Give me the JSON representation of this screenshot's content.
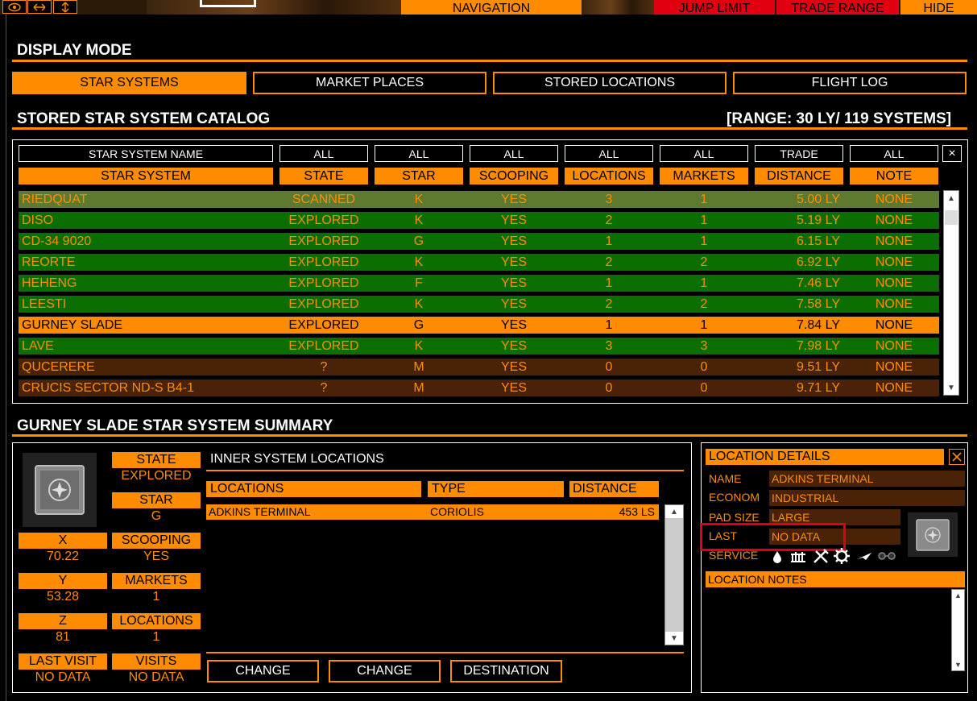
{
  "topbar": {
    "navigation": "NAVIGATION",
    "jump_limit": "JUMP LIMIT",
    "trade_range": "TRADE RANGE",
    "hide": "HIDE",
    "icons": [
      "eye-icon",
      "horizontal-arrows-icon",
      "vertical-arrows-icon"
    ]
  },
  "display_mode": {
    "title": "DISPLAY MODE",
    "buttons": [
      "STAR SYSTEMS",
      "MARKET PLACES",
      "STORED LOCATIONS",
      "FLIGHT LOG"
    ],
    "active": 0
  },
  "catalog": {
    "title": "STORED STAR SYSTEM CATALOG",
    "range": "[RANGE: 30 LY/ 119 SYSTEMS]",
    "filters": [
      "STAR SYSTEM NAME",
      "ALL",
      "ALL",
      "ALL",
      "ALL",
      "ALL",
      "TRADE",
      "ALL"
    ],
    "close": "×",
    "headers": [
      "STAR SYSTEM",
      "STATE",
      "STAR",
      "SCOOPING",
      "LOCATIONS",
      "MARKETS",
      "DISTANCE",
      "NOTE"
    ],
    "rows": [
      {
        "name": "RIEDQUAT",
        "state": "SCANNED",
        "star": "K",
        "scooping": "YES",
        "locations": "3",
        "markets": "1",
        "distance": "5.00 LY",
        "note": "NONE",
        "style": "sc"
      },
      {
        "name": "DISO",
        "state": "EXPLORED",
        "star": "K",
        "scooping": "YES",
        "locations": "2",
        "markets": "1",
        "distance": "5.19 LY",
        "note": "NONE",
        "style": "g"
      },
      {
        "name": "CD-34 9020",
        "state": "EXPLORED",
        "star": "G",
        "scooping": "YES",
        "locations": "1",
        "markets": "1",
        "distance": "6.15 LY",
        "note": "NONE",
        "style": "g"
      },
      {
        "name": "REORTE",
        "state": "EXPLORED",
        "star": "K",
        "scooping": "YES",
        "locations": "2",
        "markets": "2",
        "distance": "6.92 LY",
        "note": "NONE",
        "style": "g"
      },
      {
        "name": "HEHENG",
        "state": "EXPLORED",
        "star": "F",
        "scooping": "YES",
        "locations": "1",
        "markets": "1",
        "distance": "7.46 LY",
        "note": "NONE",
        "style": "g"
      },
      {
        "name": "LEESTI",
        "state": "EXPLORED",
        "star": "K",
        "scooping": "YES",
        "locations": "2",
        "markets": "2",
        "distance": "7.58 LY",
        "note": "NONE",
        "style": "g"
      },
      {
        "name": "GURNEY SLADE",
        "state": "EXPLORED",
        "star": "G",
        "scooping": "YES",
        "locations": "1",
        "markets": "1",
        "distance": "7.84 LY",
        "note": "NONE",
        "style": "sel"
      },
      {
        "name": "LAVE",
        "state": "EXPLORED",
        "star": "K",
        "scooping": "YES",
        "locations": "3",
        "markets": "3",
        "distance": "7.98 LY",
        "note": "NONE",
        "style": "g"
      },
      {
        "name": "QUCERERE",
        "state": "?",
        "star": "M",
        "scooping": "YES",
        "locations": "0",
        "markets": "0",
        "distance": "9.51 LY",
        "note": "NONE",
        "style": "r"
      },
      {
        "name": "CRUCIS SECTOR ND-S B4-1",
        "state": "?",
        "star": "M",
        "scooping": "YES",
        "locations": "0",
        "markets": "0",
        "distance": "9.71 LY",
        "note": "NONE",
        "style": "r"
      }
    ]
  },
  "summary": {
    "title": "GURNEY SLADE STAR SYSTEM SUMMARY",
    "state_label": "STATE",
    "state_value": "EXPLORED",
    "star_label": "STAR",
    "star_value": "G",
    "x_label": "X",
    "x_value": "70.22",
    "scooping_label": "SCOOPING",
    "scooping_value": "YES",
    "y_label": "Y",
    "y_value": "53.28",
    "markets_label": "MARKETS",
    "markets_value": "1",
    "z_label": "Z",
    "z_value": "81",
    "locations_label": "LOCATIONS",
    "locations_value": "1",
    "last_visit_label": "LAST VISIT",
    "last_visit_value": "NO DATA",
    "visits_label": "VISITS",
    "visits_value": "NO DATA",
    "inner_title": "INNER SYSTEM LOCATIONS",
    "inner_headers": [
      "LOCATIONS",
      "TYPE",
      "DISTANCE"
    ],
    "inner_rows": [
      {
        "name": "ADKINS TERMINAL",
        "type": "CORIOLIS",
        "distance": "453 LS"
      }
    ],
    "buttons": [
      "CHANGE",
      "CHANGE",
      "DESTINATION"
    ]
  },
  "location_details": {
    "title": "LOCATION DETAILS",
    "name_label": "NAME",
    "name_value": "ADKINS TERMINAL",
    "econom_label": "ECONOM",
    "econom_value": "INDUSTRIAL",
    "pad_label": "PAD SIZE",
    "pad_value": "LARGE",
    "last_label": "LAST",
    "last_value": "NO DATA",
    "service_label": "SERVICE",
    "service_icons": [
      "water-drop-icon",
      "refinery-icon",
      "repair-icon",
      "gear-icon",
      "ship-icon",
      "glasses-icon"
    ],
    "notes_title": "LOCATION NOTES"
  },
  "colors": {
    "accent": "#ff8c00",
    "explored_row": "#0a6e00",
    "unknown_row": "#4a2208",
    "scanned_row": "#5e7a2e",
    "highlight": "#e00010"
  }
}
